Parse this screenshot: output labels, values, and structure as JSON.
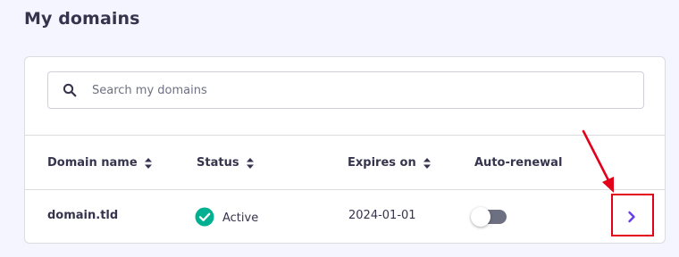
{
  "page": {
    "title": "My domains"
  },
  "search": {
    "placeholder": "Search my domains",
    "icon": "search-icon"
  },
  "table": {
    "columns": [
      {
        "label": "Domain name",
        "sortable": true
      },
      {
        "label": "Status",
        "sortable": true
      },
      {
        "label": "Expires on",
        "sortable": true
      },
      {
        "label": "Auto-renewal",
        "sortable": false
      }
    ],
    "rows": [
      {
        "domain": "domain.tld",
        "status": "Active",
        "expires": "2024-01-01",
        "auto_renewal": false
      }
    ]
  },
  "colors": {
    "background": "#f4f5ff",
    "text": "#36344d",
    "active_green": "#00b090",
    "toggle_off": "#6d7081",
    "accent": "#673de6",
    "annotation_red": "#e3001b"
  }
}
